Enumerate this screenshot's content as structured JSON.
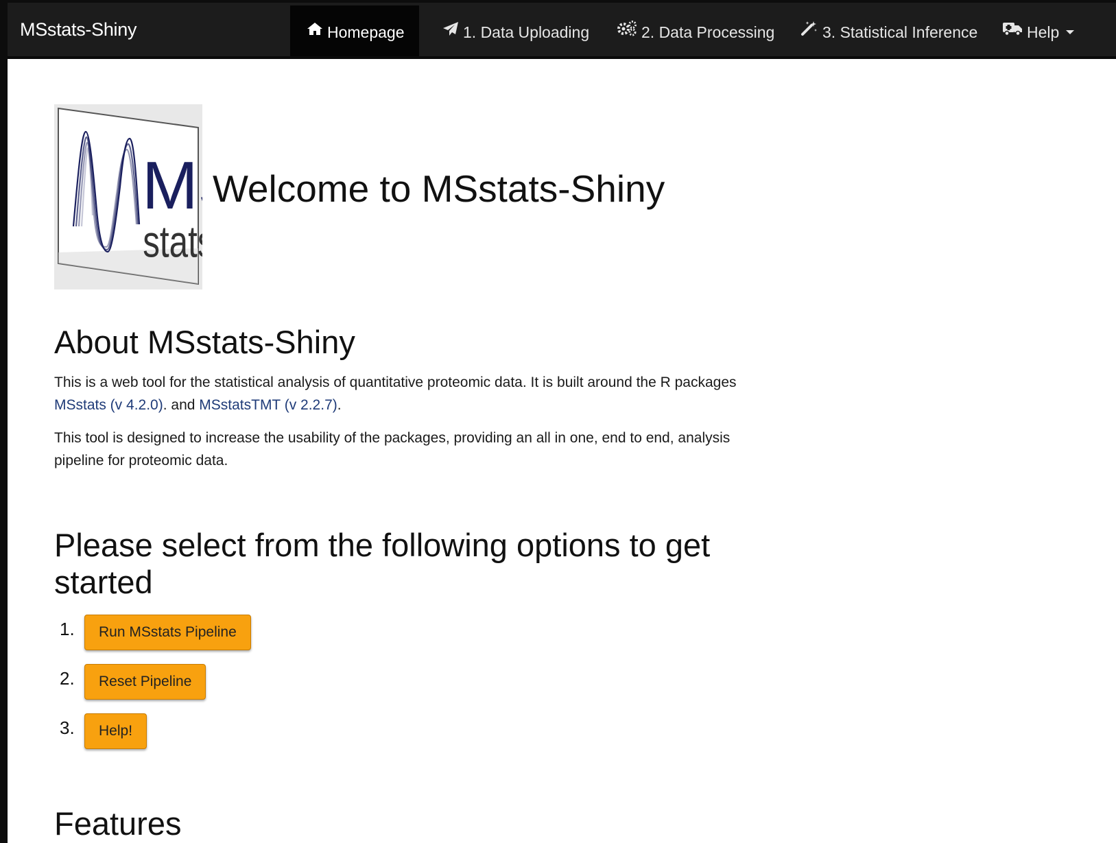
{
  "navbar": {
    "brand": "MSstats-Shiny",
    "items": [
      {
        "label": "Homepage",
        "icon": "home-icon",
        "active": true
      },
      {
        "label": "1. Data Uploading",
        "icon": "paper-plane-icon"
      },
      {
        "label": "2. Data Processing",
        "icon": "gears-icon"
      },
      {
        "label": "3. Statistical Inference",
        "icon": "magic-wand-icon"
      },
      {
        "label": "Help",
        "icon": "ambulance-icon",
        "dropdown": true
      }
    ]
  },
  "main": {
    "logo": {
      "text_large": "MS",
      "text_small": "stats"
    },
    "title": "Welcome to MSstats-Shiny",
    "about": {
      "heading": "About MSstats-Shiny",
      "para1": {
        "part1": "This is a web tool for the statistical analysis of quantitative proteomic data. It is built around the R packages ",
        "link1": "MSstats (v 4.2.0)",
        "part2": ". and ",
        "link2": "MSstatsTMT (v 2.2.7)",
        "part3": "."
      },
      "para2": "This tool is designed to increase the usability of the packages, providing an all in one, end to end, analysis pipeline for proteomic data."
    },
    "options": {
      "heading": "Please select from the following options to get started",
      "items": [
        {
          "num": "1.",
          "label": "Run MSstats Pipeline"
        },
        {
          "num": "2.",
          "label": "Reset Pipeline"
        },
        {
          "num": "3.",
          "label": "Help!"
        }
      ]
    },
    "features_heading": "Features"
  },
  "colors": {
    "navbar_bg": "#1c1c1c",
    "navbar_active_bg": "#050505",
    "button_bg": "#f8a10f",
    "link": "#1f3b78",
    "logo_wave": "#1a1f5e"
  }
}
